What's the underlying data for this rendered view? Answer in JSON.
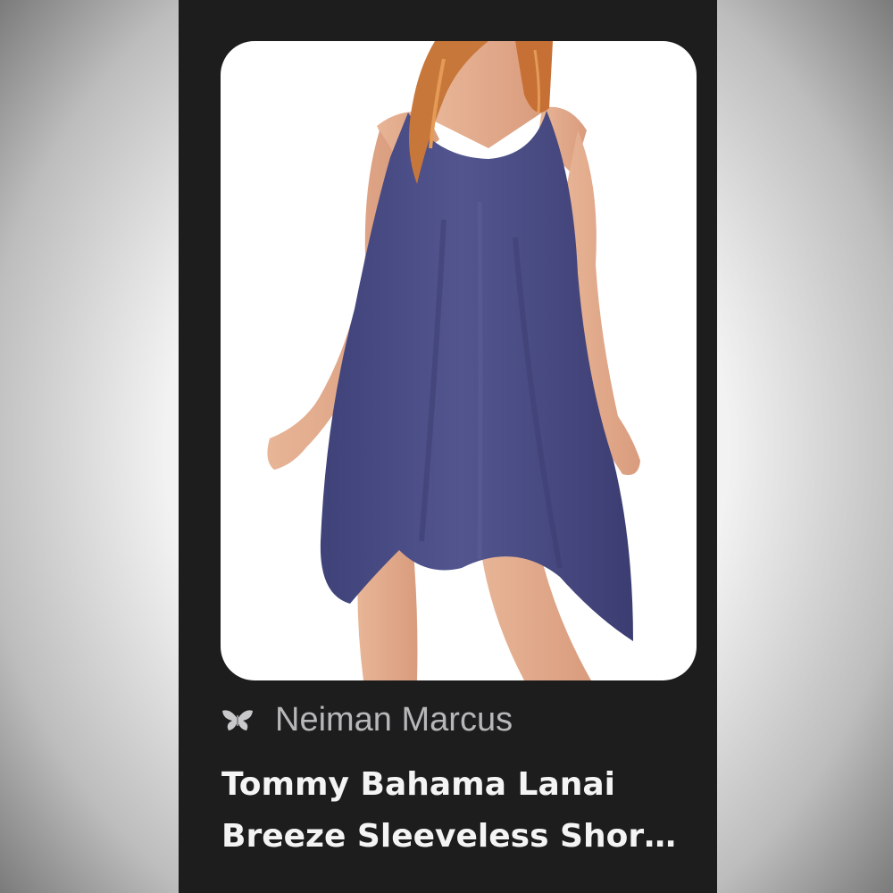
{
  "result_card": {
    "image_icon": "dress-photo",
    "source": {
      "icon": "butterfly-icon",
      "name": "Neiman Marcus"
    },
    "title_lines": [
      "Tommy Bahama Lanai",
      "Breeze Sleeveless Shor…"
    ]
  },
  "colors": {
    "panel_background": "#1d1d1e",
    "image_background": "#ffffff",
    "dress": "#4a4c86",
    "source_text": "#b7b7b9",
    "title_text": "#f4f4f4"
  }
}
